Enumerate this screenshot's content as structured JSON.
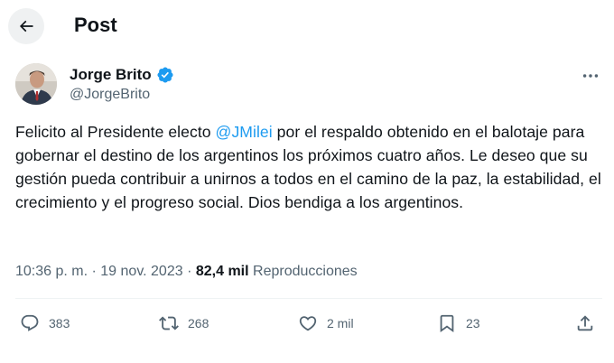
{
  "header": {
    "back_icon": "arrow-left-icon",
    "title": "Post"
  },
  "author": {
    "name": "Jorge Brito",
    "handle": "@JorgeBrito",
    "verified_icon": "verified-badge-icon",
    "verified_color": "#1d9bf0"
  },
  "tweet": {
    "text_before": "Felicito al Presidente electo ",
    "mention": "@JMilei",
    "text_after": " por el respaldo obtenido en el balotaje para gobernar el destino de los argentinos los próximos cuatro años. Le deseo que su gestión pueda contribuir a unirnos a todos en el camino de la paz, la estabilidad, el crecimiento y el progreso social. Dios bendiga a los argentinos."
  },
  "meta": {
    "time": "10:36 p. m.",
    "separator": "·",
    "date": "19 nov. 2023",
    "views_count": "82,4 mil",
    "views_label": "Reproducciones"
  },
  "actions": {
    "replies": "383",
    "reposts": "268",
    "likes": "2 mil",
    "bookmarks": "23"
  },
  "colors": {
    "accent": "#1d9bf0",
    "text_primary": "#0f1419",
    "text_secondary": "#536471"
  }
}
